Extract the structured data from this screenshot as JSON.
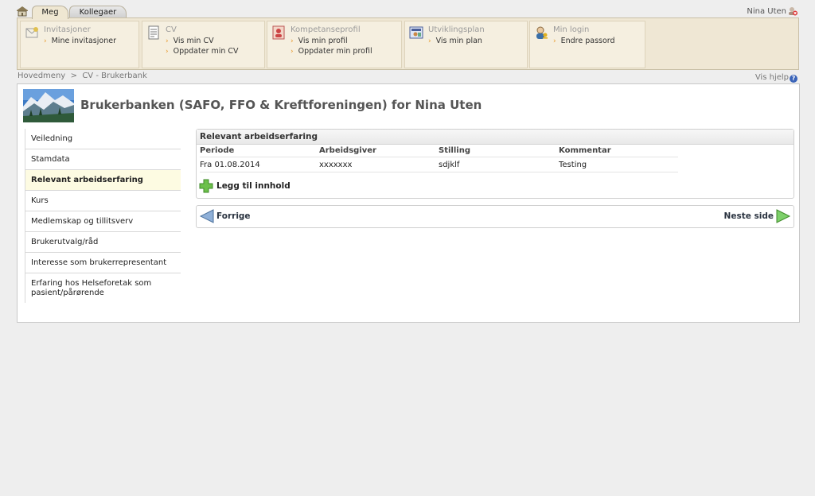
{
  "top": {
    "tabs": [
      {
        "label": "Meg"
      },
      {
        "label": "Kollegaer"
      }
    ],
    "user_name": "Nina Uten"
  },
  "menu": [
    {
      "title": "Invitasjoner",
      "icon": "invitation-icon",
      "links": [
        "Mine invitasjoner"
      ]
    },
    {
      "title": "CV",
      "icon": "cv-document-icon",
      "links": [
        "Vis min CV",
        "Oppdater min CV"
      ]
    },
    {
      "title": "Kompetanseprofil",
      "icon": "competence-profile-icon",
      "links": [
        "Vis min profil",
        "Oppdater min profil"
      ]
    },
    {
      "title": "Utviklingsplan",
      "icon": "development-plan-icon",
      "links": [
        "Vis min plan"
      ]
    },
    {
      "title": "Min login",
      "icon": "user-key-icon",
      "links": [
        "Endre passord"
      ]
    }
  ],
  "breadcrumb": {
    "items": [
      "Hovedmeny",
      "CV - Brukerbank"
    ],
    "separator": ">"
  },
  "help": {
    "label": "Vis hjelp"
  },
  "page_title": "Brukerbanken (SAFO, FFO & Kreftforeningen) for Nina Uten",
  "side_nav": {
    "items": [
      {
        "label": "Veiledning"
      },
      {
        "label": "Stamdata"
      },
      {
        "label": "Relevant arbeidserfaring"
      },
      {
        "label": "Kurs"
      },
      {
        "label": "Medlemskap og tillitsverv"
      },
      {
        "label": "Brukerutvalg/råd"
      },
      {
        "label": "Interesse som brukerrepresentant"
      },
      {
        "label": "Erfaring hos Helseforetak som pasient/pårørende"
      }
    ],
    "active": "Relevant arbeidserfaring"
  },
  "section": {
    "title": "Relevant arbeidserfaring",
    "columns": [
      "Periode",
      "Arbeidsgiver",
      "Stilling",
      "Kommentar"
    ],
    "rows": [
      [
        "Fra 01.08.2014",
        "xxxxxxx",
        "sdjklf",
        "Testing"
      ]
    ],
    "add_label": "Legg til innhold"
  },
  "pager": {
    "prev_label": "Forrige",
    "next_label": "Neste side"
  },
  "colors": {
    "menu_band": "#efe7d4",
    "active_nav": "#fdfbe2",
    "chevron": "#e89a2a",
    "help_badge": "#3a63b8"
  }
}
